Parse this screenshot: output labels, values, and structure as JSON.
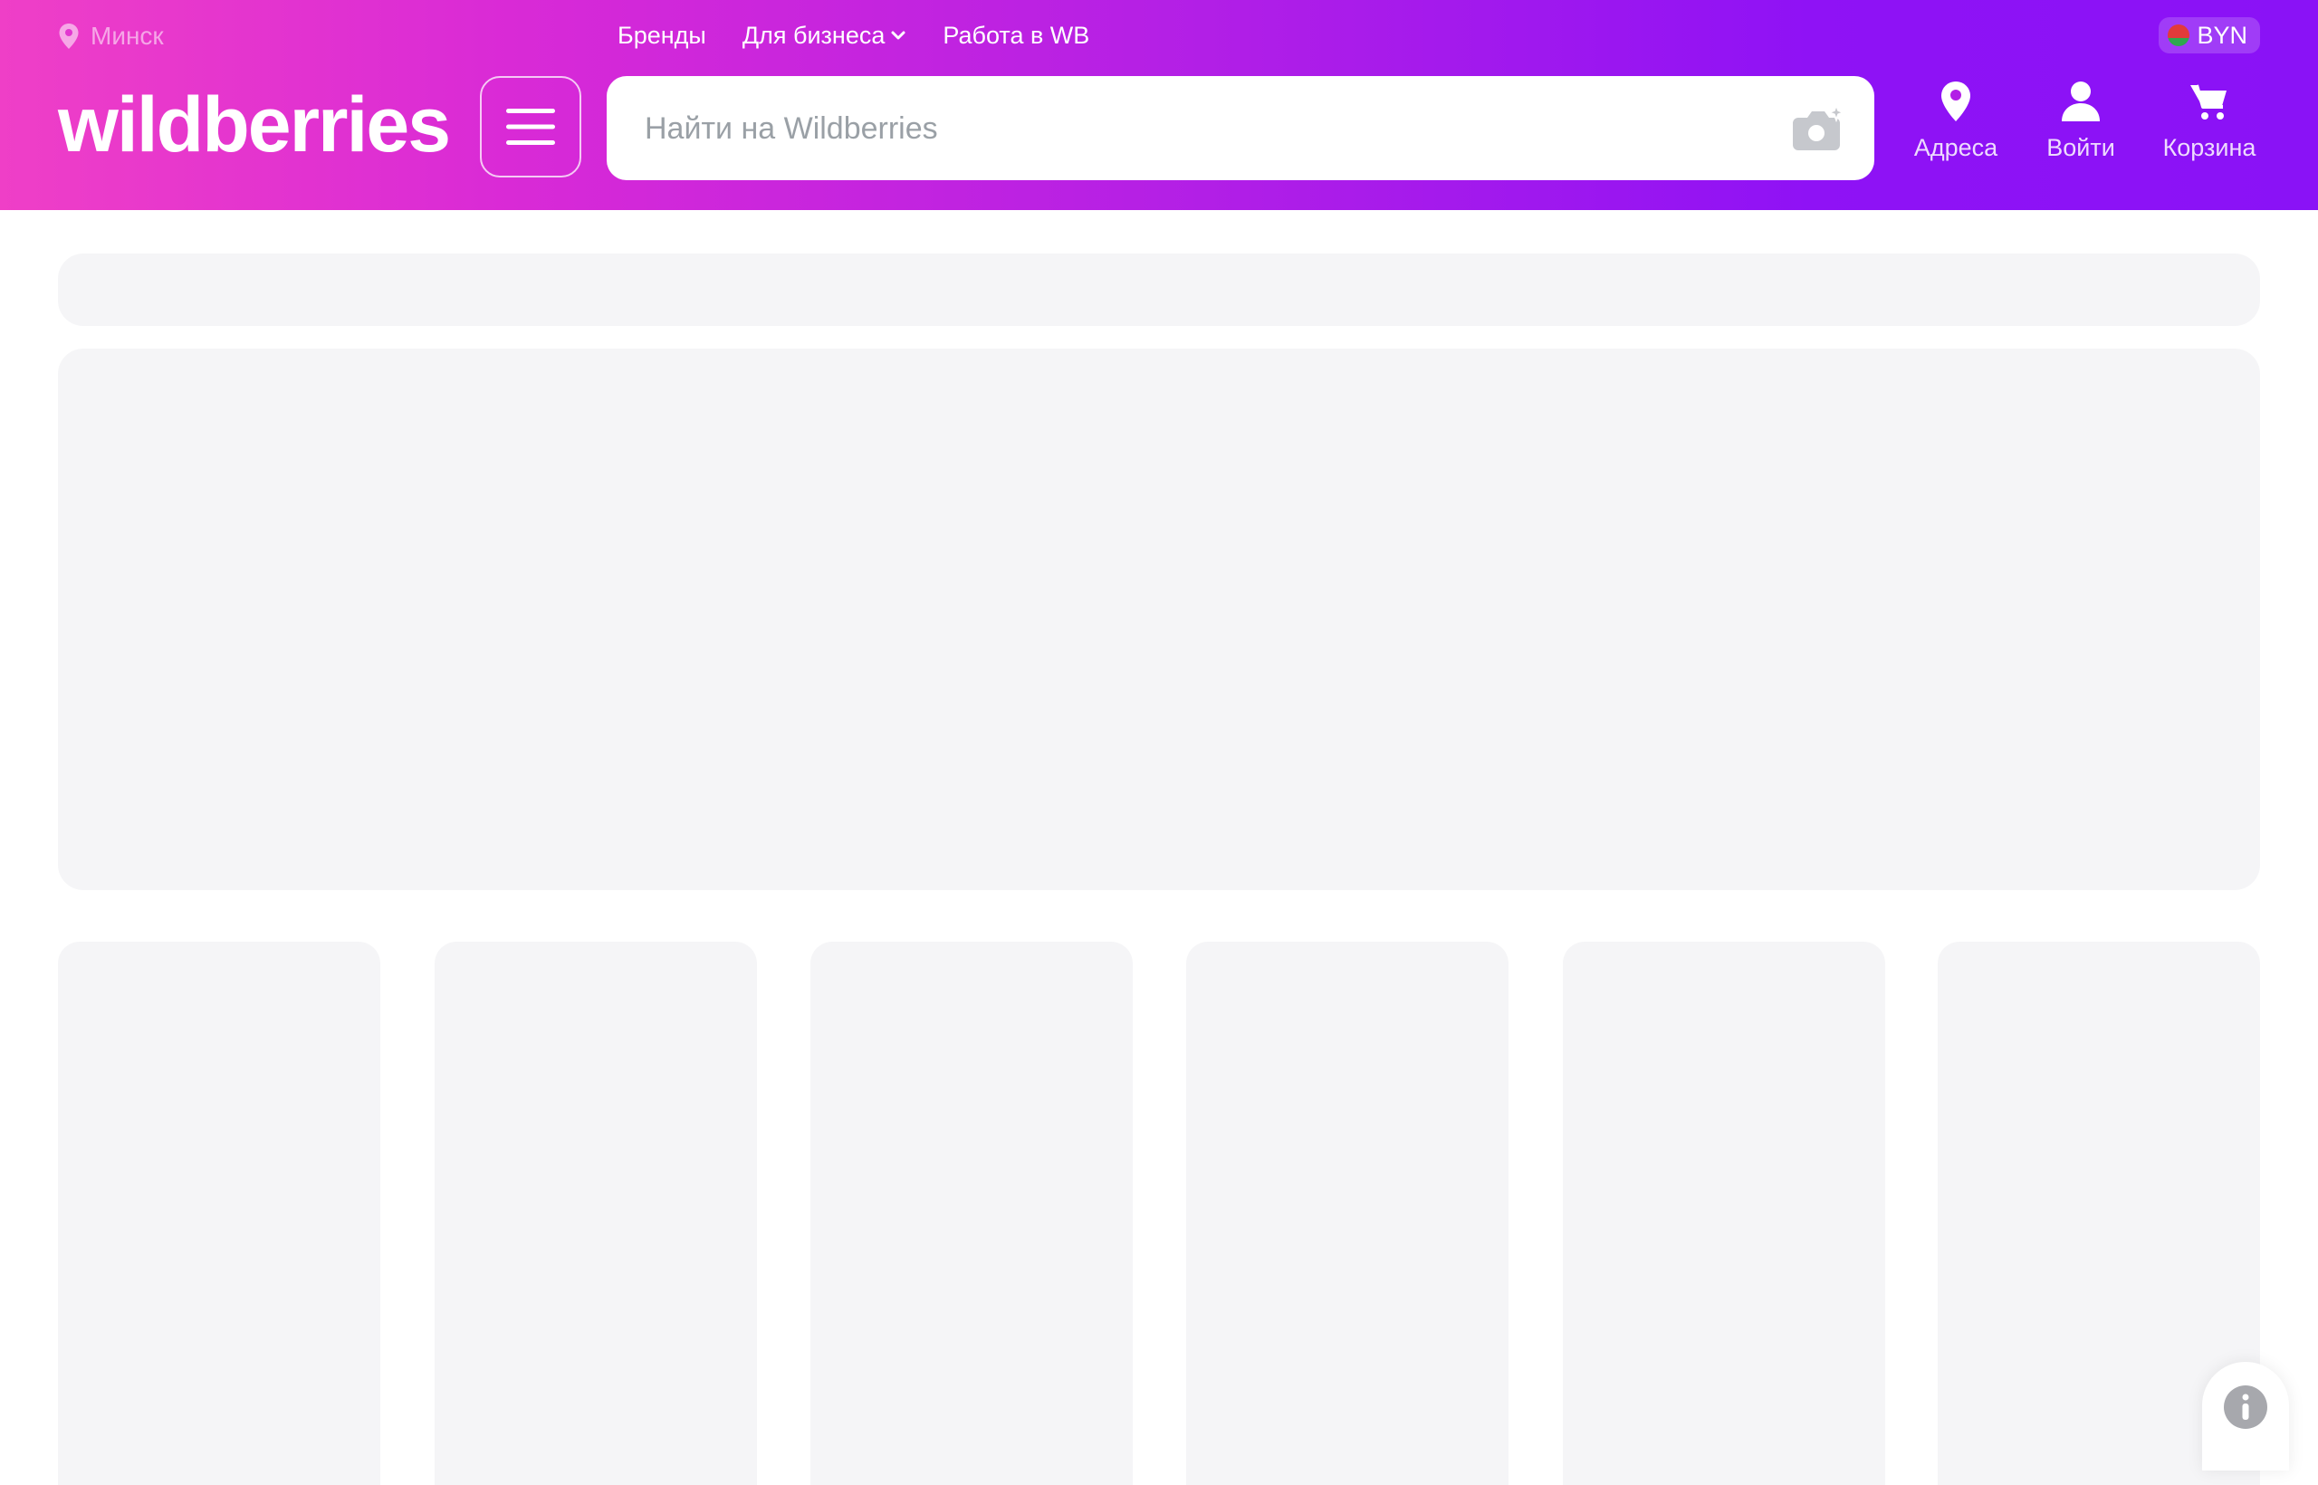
{
  "topbar": {
    "city": "Минск",
    "links": {
      "brands": "Бренды",
      "business": "Для бизнеса",
      "work": "Работа в WB"
    },
    "currency": "BYN"
  },
  "header": {
    "logo": "wildberries",
    "search_placeholder": "Найти на Wildberries",
    "nav": {
      "addresses": "Адреса",
      "login": "Войти",
      "cart": "Корзина"
    }
  },
  "icons": {
    "location": "map-pin-icon",
    "menu": "hamburger-icon",
    "camera": "camera-icon",
    "user": "user-icon",
    "cart": "cart-icon",
    "info": "info-icon",
    "chevron": "chevron-down-icon"
  },
  "colors": {
    "header_gradient_start": "#ef3fc7",
    "header_gradient_end": "#8a12f6",
    "skeleton": "#f5f5f7"
  }
}
